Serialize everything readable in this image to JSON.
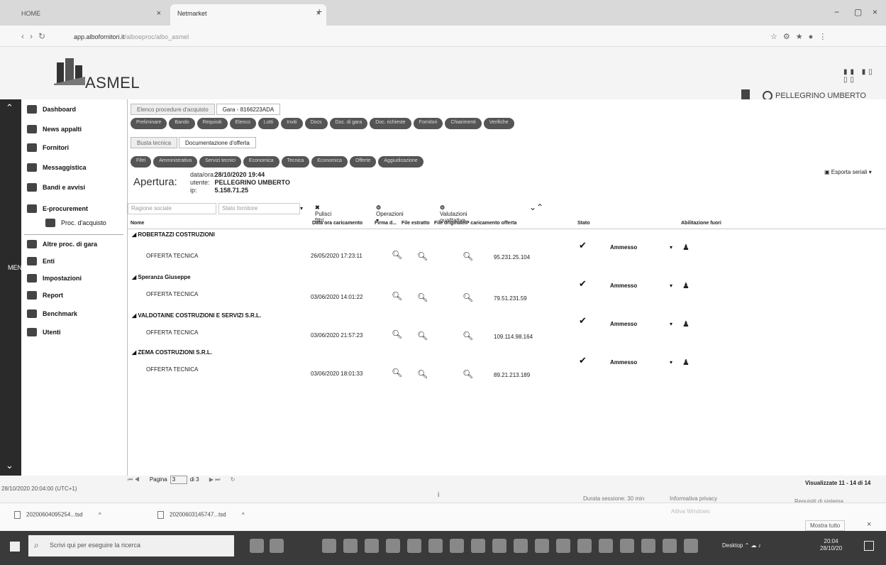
{
  "browser": {
    "tab1": "HOME",
    "tab2": "Netmarket",
    "url_host": "app.albofornitori.it",
    "url_path": "/alboeproc/albo_asmel"
  },
  "app": {
    "logo": "ASMEL",
    "user": "PELLEGRINO UMBERTO",
    "menu_vertical": "MENU"
  },
  "sidebar": {
    "items": [
      {
        "label": "Dashboard",
        "icon": "home-icon"
      },
      {
        "label": "News appalti",
        "icon": "news-icon"
      },
      {
        "label": "Fornitori",
        "icon": "suppliers-icon"
      },
      {
        "label": "Messaggistica",
        "icon": "mail-icon"
      },
      {
        "label": "Bandi e avvisi",
        "icon": "megaphone-icon"
      },
      {
        "label": "E-procurement",
        "icon": "procurement-icon"
      },
      {
        "label": "Proc. d'acquisto",
        "icon": "list-icon"
      },
      {
        "label": "Altre proc. di gara",
        "icon": "folder-icon"
      },
      {
        "label": "Enti",
        "icon": "building-icon"
      },
      {
        "label": "Impostazioni",
        "icon": "gear-icon"
      },
      {
        "label": "Report",
        "icon": "chart-icon"
      },
      {
        "label": "Benchmark",
        "icon": "benchmark-icon"
      },
      {
        "label": "Utenti",
        "icon": "users-icon"
      }
    ]
  },
  "main": {
    "top_tabs": [
      "Elenco procedure d'acquisto",
      "Gara - 8166223ADA"
    ],
    "pills_row1": [
      "Preliminare",
      "Bando",
      "Requisiti",
      "Elenco",
      "Lotti",
      "Inviti",
      "Docs",
      "Doc. di gara",
      "Doc. richieste",
      "Fornitori",
      "Chiarimenti",
      "Verifiche"
    ],
    "sub_tabs": [
      "Busta tecnica",
      "Documentazione d'offerta"
    ],
    "pills_row2": [
      "Filtri",
      "Amministrativa",
      "Servizi tecnici",
      "Economica",
      "Tecnica",
      "Economica",
      "Offerte",
      "Aggiudicazione"
    ],
    "apertura_label": "Apertura:",
    "meta": {
      "data_label": "data/ora:",
      "data_value": "28/10/2020 19:44",
      "utente_label": "utente:",
      "utente_value": "PELLEGRINO UMBERTO",
      "ip_label": "ip:",
      "ip_value": "5.158.71.25"
    },
    "export": "Esporta seriali"
  },
  "filters": {
    "search_placeholder": "Ragione sociale",
    "stato_placeholder": "Stato fornitore",
    "clear": "Pulisci filtri",
    "operations": "Operazioni",
    "qualitative": "Valutazioni qualitative"
  },
  "table": {
    "headers": [
      "Nome",
      "Data ora caricamento",
      "Firma d...",
      "File estratto",
      "File originale",
      "IP caricamento offerta",
      "Stato",
      "Abilitazione fuori"
    ],
    "groups": [
      {
        "name": "ROBERTAZZI COSTRUZIONI",
        "offer": "OFFERTA TECNICA",
        "date": "26/05/2020 17:23:11",
        "ip": "95.231.25.104",
        "stato": "Ammesso"
      },
      {
        "name": "Speranza Giuseppe",
        "offer": "OFFERTA TECNICA",
        "date": "03/06/2020 14:01:22",
        "ip": "79.51.231.59",
        "stato": "Ammesso"
      },
      {
        "name": "VALDOTAINE COSTRUZIONI E SERVIZI S.R.L.",
        "offer": "OFFERTA TECNICA",
        "date": "03/06/2020 21:57:23",
        "ip": "109.114.98.164",
        "stato": "Ammesso"
      },
      {
        "name": "ZEMA COSTRUZIONI S.R.L.",
        "offer": "OFFERTA TECNICA",
        "date": "03/06/2020 18:01:33",
        "ip": "89.21.213.189",
        "stato": "Ammesso"
      }
    ]
  },
  "pager": {
    "page_label": "Pagina",
    "page": "3",
    "of": "di 3",
    "visualized": "Visualizzate 11 - 14 di 14"
  },
  "footer": {
    "timestamp": "28/10/2020 20:04:00 (UTC+1)",
    "duration": "Durata sessione: 30 min",
    "privacy": "Informativa privacy",
    "requirements": "Requisiti di sistema",
    "center_mark": "i",
    "windows_activate": "Attiva Windows"
  },
  "downloads": {
    "file1": "20200604095254...tsd",
    "file2": "20200603145747...tsd",
    "show_all": "Mostra tutto"
  },
  "taskbar": {
    "search": "Scrivi qui per eseguire la ricerca",
    "desktop": "Desktop",
    "time": "20:04",
    "date": "28/10/20"
  }
}
